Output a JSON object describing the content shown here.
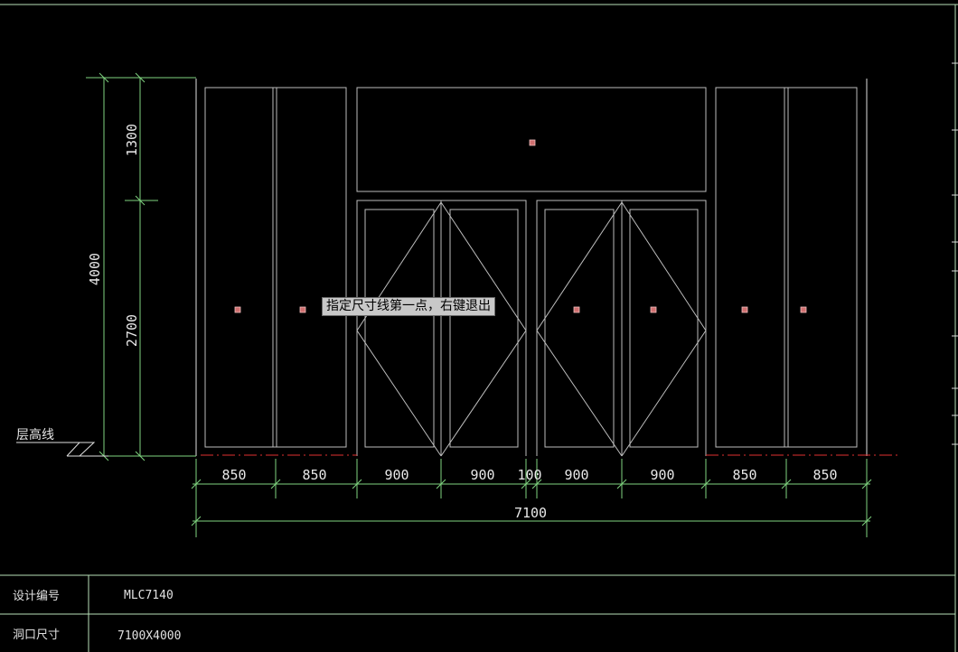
{
  "prompt_tooltip": "指定尺寸线第一点，右键退出",
  "floor_line_label": "层高线",
  "vertical_dims": {
    "total": "4000",
    "upper": "1300",
    "lower": "2700"
  },
  "horizontal_dims": [
    "850",
    "850",
    "900",
    "900",
    "100",
    "900",
    "900",
    "850",
    "850"
  ],
  "overall_width": "7100",
  "title_block": [
    {
      "label": "设计编号",
      "value": "MLC7140"
    },
    {
      "label": "洞口尺寸",
      "value": "7100X4000"
    }
  ],
  "colors": {
    "background": "#000000",
    "frame": "#ffffff",
    "window_lines": "#bdbdbd",
    "dimension": "#7fd47f",
    "red_dashed": "#e03030",
    "grip": "#d07070"
  }
}
